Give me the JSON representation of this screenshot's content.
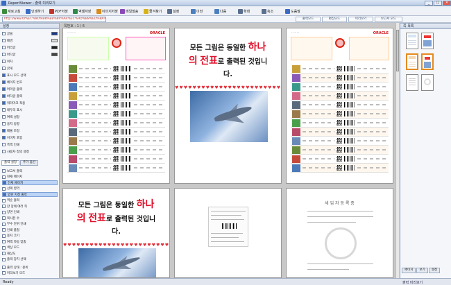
{
  "window": {
    "title": "ReportViewer - 출력 미리보기",
    "buttons": [
      "_",
      "□",
      "✕"
    ]
  },
  "toolbar": [
    {
      "label": "새로고침",
      "color": "#3a8d3a"
    },
    {
      "label": "인쇄하기",
      "color": "#3a6bc5"
    },
    {
      "label": "PDF저장",
      "color": "#c0352b"
    },
    {
      "label": "엑셀저장",
      "color": "#2c8a4b"
    },
    {
      "label": "이미지저장",
      "color": "#d98b1c"
    },
    {
      "label": "메일발송",
      "color": "#8a4ab8"
    },
    {
      "label": "즐겨찾기",
      "color": "#d6b21a"
    },
    {
      "label": "설정",
      "color": "#5a6f8f"
    },
    {
      "label": "이전",
      "color": "#4a7fc0"
    },
    {
      "label": "다음",
      "color": "#4a7fc0"
    },
    {
      "label": "확대",
      "color": "#5a6f8f"
    },
    {
      "label": "축소",
      "color": "#5a6f8f"
    },
    {
      "label": "도움말",
      "color": "#3a6bc5"
    }
  ],
  "address": {
    "value": "http://www.0/%EC%9D%B8%EB%84%A4%EC%9D%B8%ED%8A%B8/demo.cgi",
    "tabs": [
      "출력모드",
      "편집모드",
      "미리보기",
      "보고서 모드"
    ]
  },
  "left": {
    "header": "설정",
    "rows": [
      {
        "label": "글꼴",
        "checked": false,
        "swatch": "#1b3a8a"
      },
      {
        "label": "배경",
        "checked": false,
        "swatch": "#dddddd"
      },
      {
        "label": "머리글",
        "checked": false,
        "swatch": "#222222"
      },
      {
        "label": "바닥글",
        "checked": false,
        "swatch": "#444444"
      },
      {
        "label": "위치",
        "checked": false,
        "swatch": ""
      },
      {
        "label": "굵게",
        "checked": false,
        "swatch": ""
      },
      {
        "label": "표시 모드 선택",
        "checked": true,
        "swatch": ""
      },
      {
        "label": "페이지 번호",
        "checked": true,
        "swatch": ""
      },
      {
        "label": "머리글 출력",
        "checked": true,
        "swatch": ""
      },
      {
        "label": "바닥글 출력",
        "checked": true,
        "swatch": ""
      },
      {
        "label": "워터마크 적용",
        "checked": true,
        "swatch": ""
      },
      {
        "label": "테두리 표시",
        "checked": false,
        "swatch": ""
      },
      {
        "label": "여백 설정",
        "checked": false,
        "swatch": ""
      },
      {
        "label": "용지 방향",
        "checked": false,
        "swatch": ""
      },
      {
        "label": "배율 조정",
        "checked": true,
        "swatch": ""
      },
      {
        "label": "이미지 포함",
        "checked": true,
        "swatch": ""
      },
      {
        "label": "흑백 인쇄",
        "checked": false,
        "swatch": ""
      },
      {
        "label": "사용자 정의 설정",
        "checked": false,
        "swatch": ""
      }
    ],
    "tabs": [
      "출력 설정",
      "추가 옵션"
    ],
    "rows2": [
      {
        "label": "보고서 출력",
        "checked": false,
        "highlight": false
      },
      {
        "label": "현재 페이지",
        "checked": false,
        "highlight": false
      },
      {
        "label": "전체 페이지",
        "checked": true,
        "highlight": true
      },
      {
        "label": "선택 영역",
        "checked": false,
        "highlight": false
      },
      {
        "label": "범위 지정 출력",
        "checked": true,
        "highlight": true
      },
      {
        "label": "역순 출력",
        "checked": false,
        "highlight": false
      },
      {
        "label": "한 장에 여러 쪽",
        "checked": false,
        "highlight": false
      },
      {
        "label": "양면 인쇄",
        "checked": false,
        "highlight": false
      },
      {
        "label": "복사본 수",
        "checked": false,
        "highlight": false
      },
      {
        "label": "부수 단위 인쇄",
        "checked": false,
        "highlight": false
      },
      {
        "label": "인쇄 품질",
        "checked": false,
        "highlight": false
      },
      {
        "label": "용지 크기",
        "checked": false,
        "highlight": false
      },
      {
        "label": "여백 자동 맞춤",
        "checked": false,
        "highlight": false
      },
      {
        "label": "색상 모드",
        "checked": false,
        "highlight": false
      },
      {
        "label": "해상도",
        "checked": false,
        "highlight": false
      },
      {
        "label": "출력 장치 선택",
        "checked": false,
        "highlight": false
      }
    ],
    "bottom": [
      "출력 상태 : 준비",
      "미리보기 모드"
    ]
  },
  "preview": {
    "label": "쪽번호 : 1 / 6",
    "invoice_brand": "ORACLE",
    "message_line1": "모든 그림은 동일한",
    "message_red1": "하나",
    "message_line2a": "의",
    "message_red2": "전표",
    "message_line2b": "로 출력된 것입니",
    "message_line3": "다.",
    "hearts": "♥♥♥♥♥♥♥♥♥♥♥♥♥♥♥♥♥♥♥♥♥♥♥♥♥♥♥♥",
    "certificate_title": "세 입 자 등 록 증"
  },
  "right": {
    "header": "쪽 목록",
    "tabs": [
      "페이지",
      "보기",
      "설정"
    ]
  },
  "status": {
    "left": "Ready",
    "right": "출력 미리보기"
  },
  "chart_data": null
}
